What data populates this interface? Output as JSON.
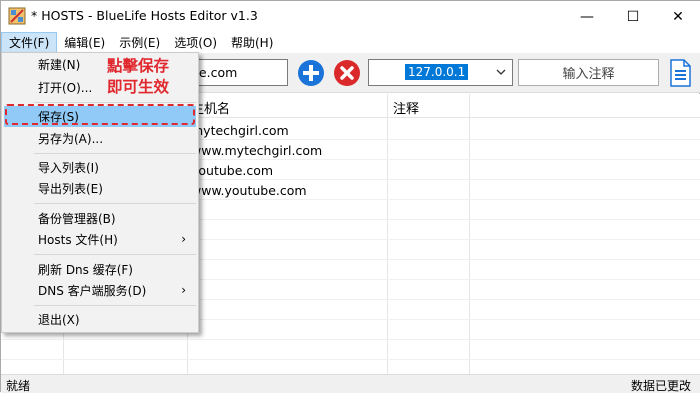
{
  "window": {
    "title": "* HOSTS - BlueLife Hosts Editor v1.3"
  },
  "controls": {
    "minimize": "—",
    "maximize": "☐",
    "close": "✕"
  },
  "menubar": [
    {
      "label": "文件(F)"
    },
    {
      "label": "编辑(E)"
    },
    {
      "label": "示例(E)"
    },
    {
      "label": "选项(O)"
    },
    {
      "label": "帮助(H)"
    }
  ],
  "toolbar": {
    "host_value": "be.com",
    "ip_selected": "127.0.0.1",
    "comment_placeholder": "输入注释"
  },
  "grid": {
    "columns": [
      "主机名",
      "注释"
    ],
    "rows": [
      {
        "host": "mytechgirl.com"
      },
      {
        "host": "www.mytechgirl.com"
      },
      {
        "host": "youtube.com"
      },
      {
        "host": "www.youtube.com"
      }
    ]
  },
  "file_menu": {
    "items": [
      {
        "label": "新建(N)"
      },
      {
        "label": "打开(O)..."
      },
      {
        "label": "保存(S)"
      },
      {
        "label": "另存为(A)..."
      },
      {
        "label": "导入列表(I)"
      },
      {
        "label": "导出列表(E)"
      },
      {
        "label": "备份管理器(B)"
      },
      {
        "label": "Hosts 文件(H)"
      },
      {
        "label": "刷新 Dns 缓存(F)"
      },
      {
        "label": "DNS 客户端服务(D)"
      },
      {
        "label": "退出(X)"
      }
    ],
    "submenu_arrow": "›"
  },
  "annotation": {
    "line1": "點擊保存",
    "line2": "即可生效"
  },
  "status": {
    "left": "就绪",
    "right": "数据已更改"
  },
  "colors": {
    "accent": "#0078d7",
    "annotation": "#e0282e",
    "add": "#1a73d9",
    "delete": "#d9292b"
  }
}
